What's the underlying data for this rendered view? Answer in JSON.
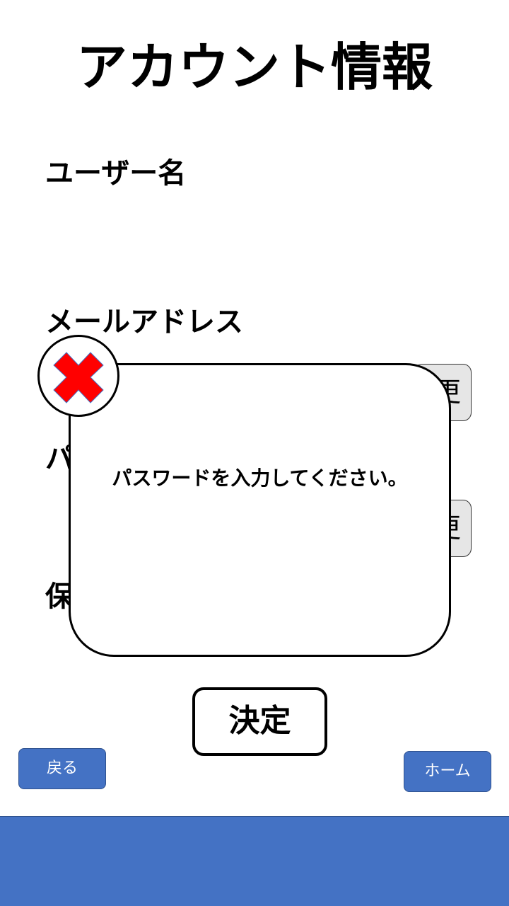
{
  "header": {
    "title": "アカウント情報"
  },
  "fields": {
    "username_label": "ユーザー名",
    "email_label": "メールアドレス",
    "password_label_visible": "パ",
    "save_label_visible": "保",
    "email_change_visible": "更",
    "password_change_visible": "更"
  },
  "dialog": {
    "icon": "error-x-icon",
    "message": "パスワードを入力してください。",
    "icon_color": "#ff0000"
  },
  "actions": {
    "confirm": "決定",
    "back": "戻る",
    "home": "ホーム"
  },
  "colors": {
    "accent": "#4472c4"
  }
}
